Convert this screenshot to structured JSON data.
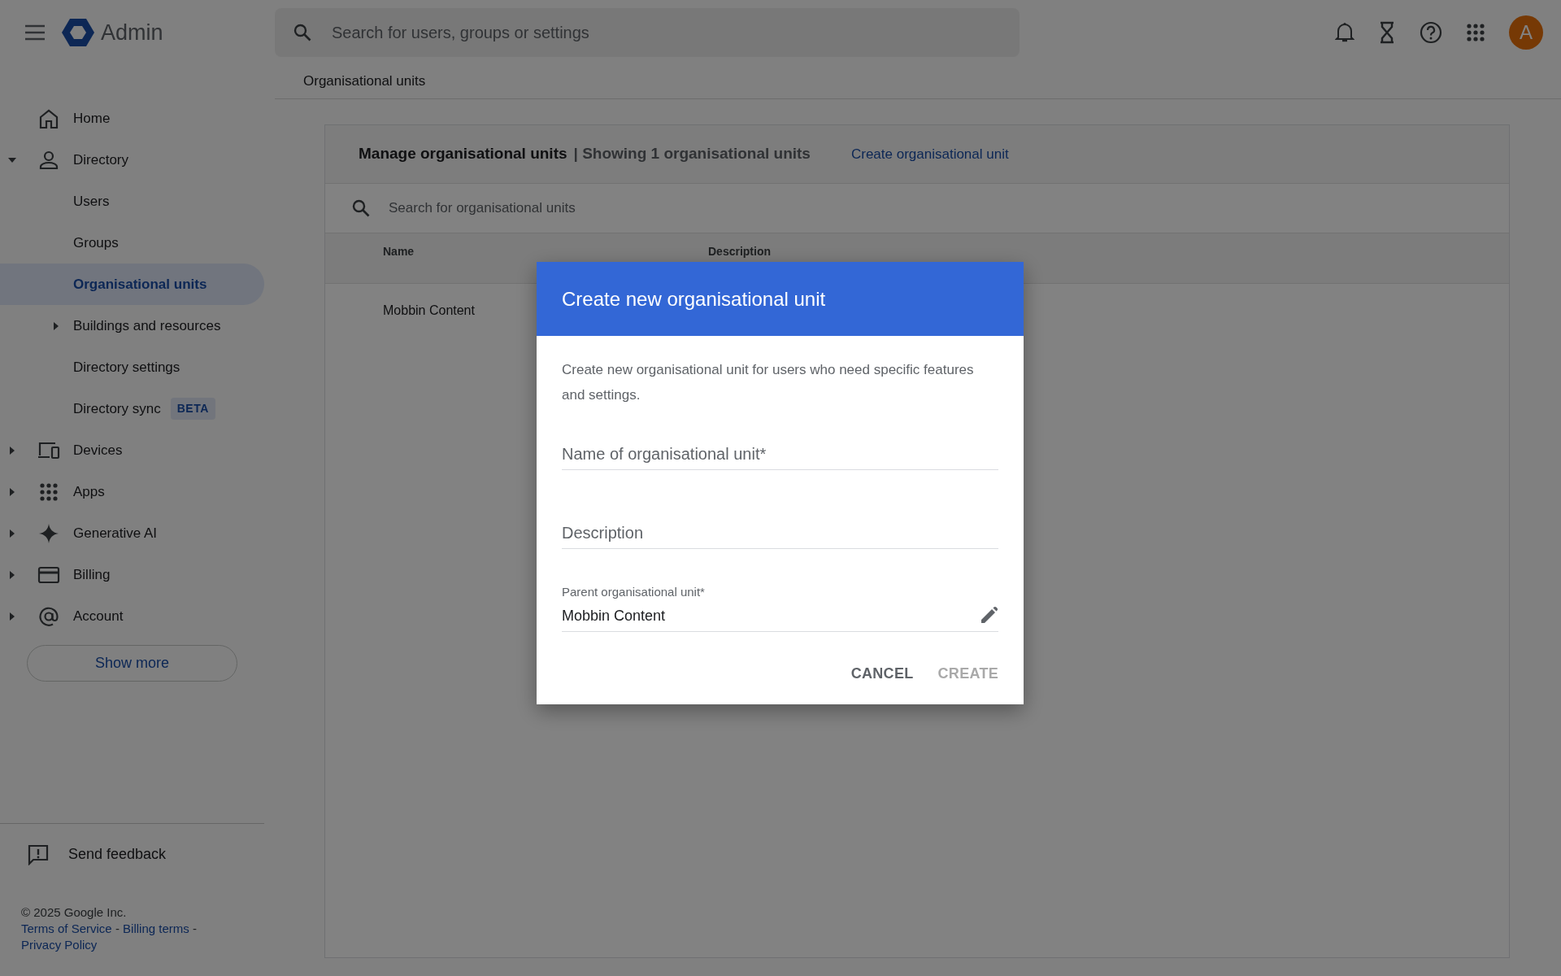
{
  "app": {
    "title": "Admin"
  },
  "search": {
    "placeholder": "Search for users, groups or settings"
  },
  "avatar": {
    "initial": "A"
  },
  "breadcrumb": "Organisational units",
  "sidebar": {
    "items": [
      {
        "label": "Home",
        "selected": false
      },
      {
        "label": "Directory",
        "selected": false,
        "expanded": true,
        "children": [
          {
            "label": "Users",
            "selected": false
          },
          {
            "label": "Groups",
            "selected": false
          },
          {
            "label": "Organisational units",
            "selected": true
          },
          {
            "label": "Buildings and resources",
            "selected": false,
            "expanded": false
          },
          {
            "label": "Directory settings",
            "selected": false
          },
          {
            "label": "Directory sync",
            "selected": false,
            "badge": "BETA"
          }
        ]
      },
      {
        "label": "Devices",
        "selected": false,
        "expanded": false
      },
      {
        "label": "Apps",
        "selected": false,
        "expanded": false
      },
      {
        "label": "Generative AI",
        "selected": false,
        "expanded": false
      },
      {
        "label": "Billing",
        "selected": false,
        "expanded": false
      },
      {
        "label": "Account",
        "selected": false,
        "expanded": false
      }
    ],
    "show_more": "Show more",
    "feedback": "Send feedback",
    "footer": {
      "copyright": "© 2025 Google Inc.",
      "separator": "-",
      "links": [
        "Terms of Service",
        "Billing terms",
        "Privacy Policy"
      ]
    }
  },
  "card": {
    "title": "Manage organisational units",
    "subtitle": "| Showing 1 organisational units",
    "action": "Create organisational unit",
    "search_placeholder": "Search for organisational units",
    "columns": [
      "Name",
      "Description"
    ],
    "rows": [
      {
        "name": "Mobbin Content"
      }
    ]
  },
  "dialog": {
    "title": "Create new organisational unit",
    "text": "Create new organisational unit for users who need specific features and settings.",
    "fields": [
      {
        "kind": "text",
        "placeholder": "Name of organisational unit*"
      },
      {
        "kind": "text",
        "placeholder": "Description"
      },
      {
        "kind": "picker",
        "label": "Parent organisational unit*",
        "value": "Mobbin Content"
      }
    ],
    "buttons": [
      {
        "label": "CANCEL",
        "disabled": false
      },
      {
        "label": "CREATE",
        "disabled": true
      }
    ]
  }
}
